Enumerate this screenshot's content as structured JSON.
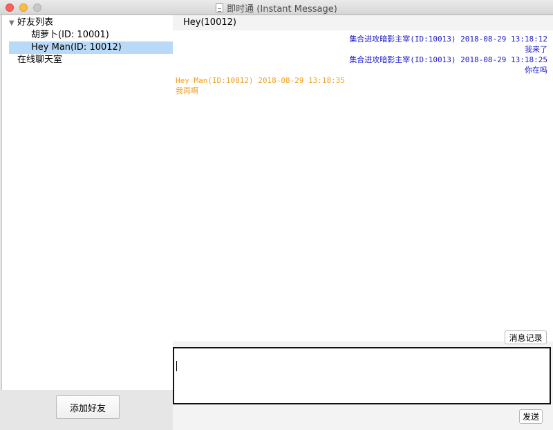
{
  "window": {
    "title": "即时通 (Instant Message)"
  },
  "sidebar": {
    "group_label": "好友列表",
    "friends": [
      {
        "label": "胡萝卜(ID: 10001)"
      },
      {
        "label": "Hey Man(ID: 10012)",
        "selected": true
      }
    ],
    "chatroom_label": "在线聊天室",
    "add_friend_label": "添加好友"
  },
  "chat": {
    "title": "Hey(10012)",
    "messages": [
      {
        "side": "right",
        "header": "集合进攻暗影主宰(ID:10013) 2018-08-29 13:18:12",
        "body": "我来了"
      },
      {
        "side": "right",
        "header": "集合进攻暗影主宰(ID:10013) 2018-08-29 13:18:25",
        "body": "你在吗"
      },
      {
        "side": "left",
        "header": "Hey Man(ID:10012) 2018-08-29 13:18:35",
        "body": "我再啊"
      }
    ],
    "history_label": "消息记录",
    "input_value": "",
    "send_label": "发送"
  },
  "colors": {
    "sent_message": "#1818c8",
    "received_message": "#f29f1e",
    "selection": "#b8d9f8"
  },
  "icons": {
    "title_document": "document-icon",
    "tree_expander": "triangle-down-icon"
  }
}
